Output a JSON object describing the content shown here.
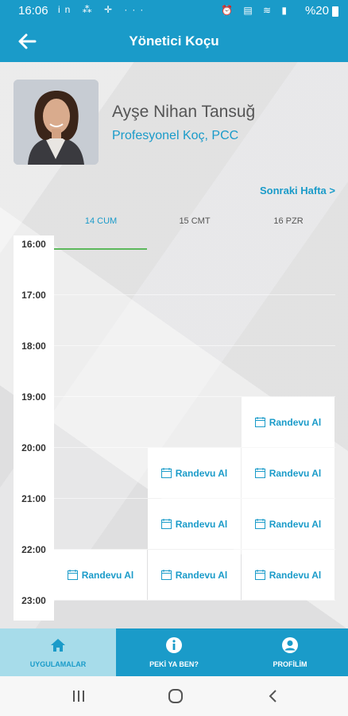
{
  "status_bar": {
    "time": "16:06",
    "left_icons": "in ⁂ ✛ ···",
    "right_icons": "⏰ ▤ ≋ ▮",
    "battery": "%20"
  },
  "header": {
    "title": "Yönetici Koçu",
    "back_icon": "arrow-left-icon"
  },
  "profile": {
    "name": "Ayşe Nihan Tansuğ",
    "title": "Profesyonel Koç, PCC"
  },
  "calendar": {
    "next_week": "Sonraki Hafta >",
    "days": [
      {
        "label": "14 CUM",
        "active": true
      },
      {
        "label": "15 CMT",
        "active": false
      },
      {
        "label": "16 PZR",
        "active": false
      }
    ],
    "hours": [
      "16:00",
      "17:00",
      "18:00",
      "19:00",
      "20:00",
      "21:00",
      "22:00",
      "23:00"
    ],
    "slot_label": "Randevu Al",
    "slots": [
      {
        "day": 2,
        "hour": "19:00"
      },
      {
        "day": 1,
        "hour": "20:00"
      },
      {
        "day": 2,
        "hour": "20:00"
      },
      {
        "day": 1,
        "hour": "21:00"
      },
      {
        "day": 2,
        "hour": "21:00"
      },
      {
        "day": 0,
        "hour": "22:00"
      },
      {
        "day": 1,
        "hour": "22:00"
      },
      {
        "day": 2,
        "hour": "22:00"
      }
    ]
  },
  "bottom_nav": [
    {
      "label": "UYGULAMALAR",
      "icon": "home-icon",
      "active": true
    },
    {
      "label": "PEKİ YA BEN?",
      "icon": "info-icon",
      "active": false
    },
    {
      "label": "PROFİLİM",
      "icon": "user-icon",
      "active": false
    }
  ],
  "colors": {
    "accent": "#1a9bc9",
    "active_nav": "#a7dcea",
    "now_line": "#5cb85c"
  }
}
